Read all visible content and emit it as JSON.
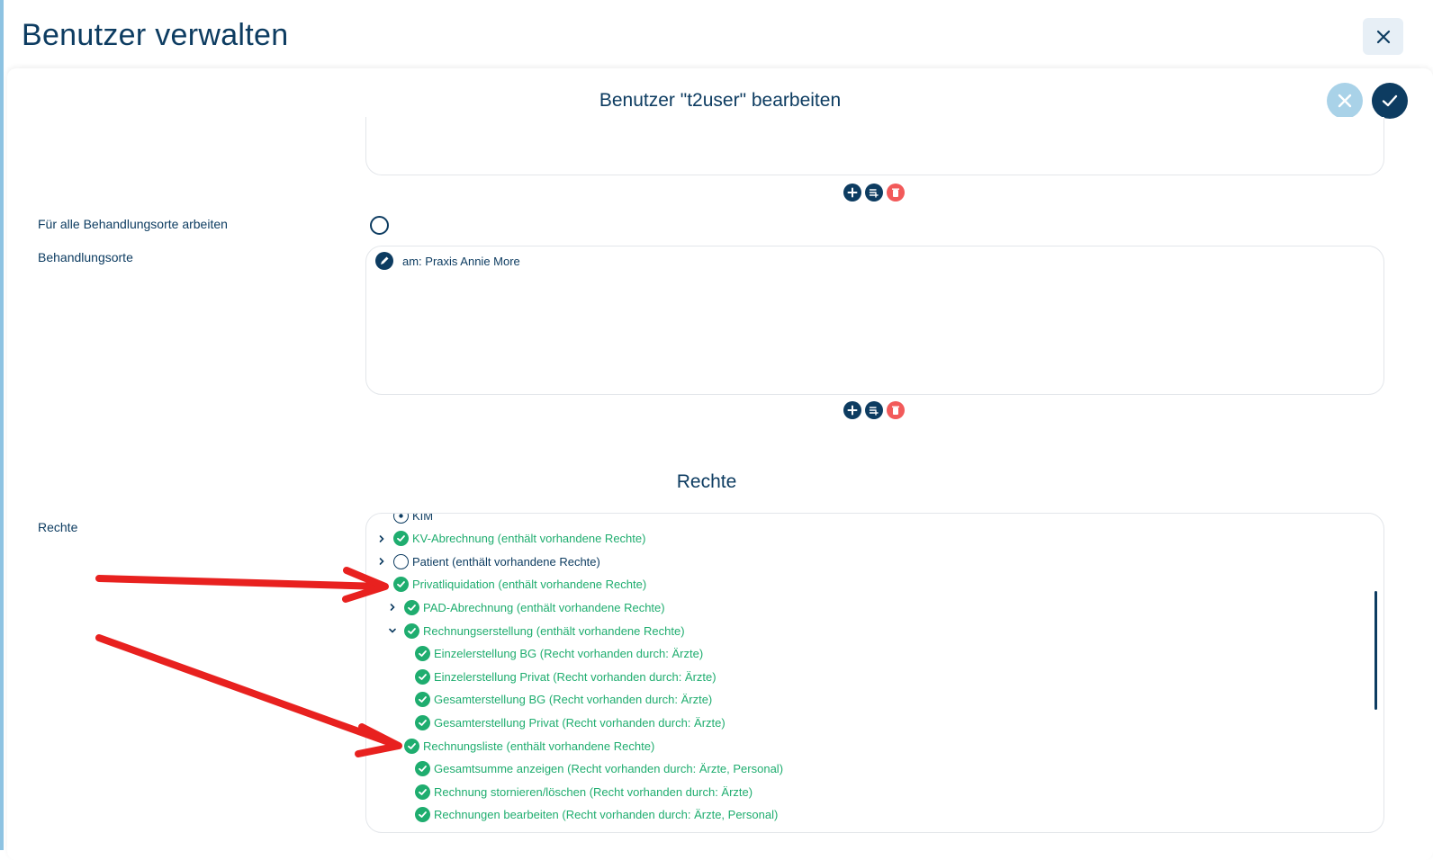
{
  "page": {
    "title": "Benutzer verwalten"
  },
  "form": {
    "title": "Benutzer \"t2user\" bearbeiten"
  },
  "fields": {
    "all_locations_label": "Für alle Behandlungsorte arbeiten",
    "locations_label": "Behandlungsorte",
    "rights_label": "Rechte"
  },
  "locations": [
    {
      "label": "am: Praxis Annie More"
    }
  ],
  "rights_section_title": "Rechte",
  "rights_tree": [
    {
      "label": "KIM",
      "checked": false,
      "level": 0,
      "expand": "none",
      "partial": true
    },
    {
      "label": "KV-Abrechnung (enthält vorhandene Rechte)",
      "checked": true,
      "level": 0,
      "expand": "collapsed"
    },
    {
      "label": "Patient (enthält vorhandene Rechte)",
      "checked": false,
      "level": 0,
      "expand": "collapsed"
    },
    {
      "label": "Privatliquidation (enthält vorhandene Rechte)",
      "checked": true,
      "level": 0,
      "expand": "expanded"
    },
    {
      "label": "PAD-Abrechnung (enthält vorhandene Rechte)",
      "checked": true,
      "level": 1,
      "expand": "collapsed"
    },
    {
      "label": "Rechnungserstellung (enthält vorhandene Rechte)",
      "checked": true,
      "level": 1,
      "expand": "expanded"
    },
    {
      "label": "Einzelerstellung BG (Recht vorhanden durch: Ärzte)",
      "checked": true,
      "level": 2,
      "expand": "none"
    },
    {
      "label": "Einzelerstellung Privat (Recht vorhanden durch: Ärzte)",
      "checked": true,
      "level": 2,
      "expand": "none"
    },
    {
      "label": "Gesamterstellung BG (Recht vorhanden durch: Ärzte)",
      "checked": true,
      "level": 2,
      "expand": "none"
    },
    {
      "label": "Gesamterstellung Privat (Recht vorhanden durch: Ärzte)",
      "checked": true,
      "level": 2,
      "expand": "none"
    },
    {
      "label": "Rechnungsliste (enthält vorhandene Rechte)",
      "checked": true,
      "level": 1,
      "expand": "none"
    },
    {
      "label": "Gesamtsumme anzeigen (Recht vorhanden durch: Ärzte, Personal)",
      "checked": true,
      "level": 2,
      "expand": "none"
    },
    {
      "label": "Rechnung stornieren/löschen (Recht vorhanden durch: Ärzte)",
      "checked": true,
      "level": 2,
      "expand": "none"
    },
    {
      "label": "Rechnungen bearbeiten (Recht vorhanden durch: Ärzte, Personal)",
      "checked": true,
      "level": 2,
      "expand": "none"
    }
  ],
  "colors": {
    "primary": "#0d3c61",
    "granted": "#1fad6f",
    "delete": "#f25a5a",
    "annotation_arrow": "#e8211f",
    "cancel": "#a9d2e8"
  },
  "icons": {
    "close": "close-icon",
    "cancel": "x-icon",
    "confirm": "check-icon",
    "add": "plus-icon",
    "add_list": "playlist-add-icon",
    "delete": "trash-icon",
    "edit": "pencil-icon"
  }
}
